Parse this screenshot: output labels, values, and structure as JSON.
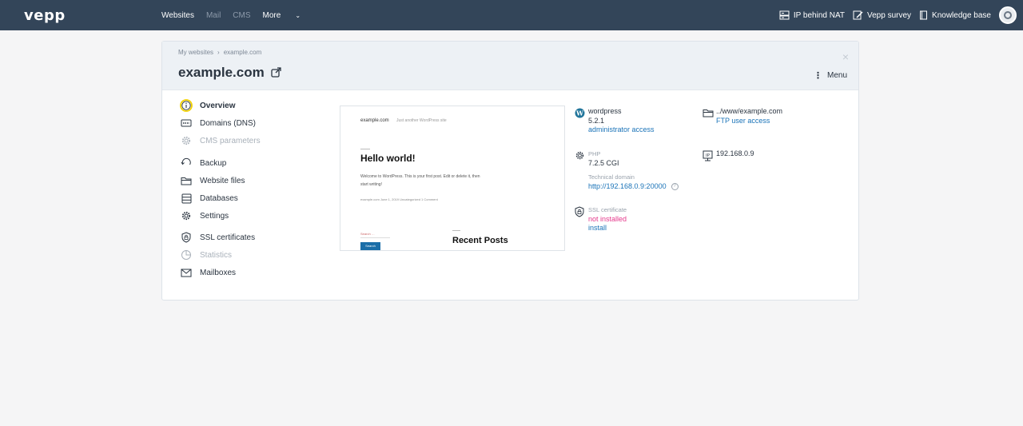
{
  "topbar": {
    "logo": "vepp",
    "nav": {
      "websites": "Websites",
      "mail": "Mail",
      "cms": "CMS",
      "more": "More"
    },
    "links": {
      "ip_behind_nat": "IP behind NAT",
      "survey": "Vepp survey",
      "knowledge_base": "Knowledge base"
    }
  },
  "card": {
    "breadcrumb": {
      "root": "My websites",
      "sep": "›",
      "current": "example.com"
    },
    "title": "example.com",
    "menu_label": "Menu",
    "close_symbol": "×"
  },
  "sidebar": {
    "items": [
      {
        "label": "Overview",
        "icon": "info-icon",
        "state": "active"
      },
      {
        "label": "Domains (DNS)",
        "icon": "dns-icon",
        "state": "normal"
      },
      {
        "label": "CMS parameters",
        "icon": "gear-icon",
        "state": "disabled"
      },
      {
        "label": "Backup",
        "icon": "backup-icon",
        "state": "normal"
      },
      {
        "label": "Website files",
        "icon": "folder-icon",
        "state": "normal"
      },
      {
        "label": "Databases",
        "icon": "database-icon",
        "state": "normal"
      },
      {
        "label": "Settings",
        "icon": "gear-icon",
        "state": "normal"
      },
      {
        "label": "SSL certificates",
        "icon": "shield-icon",
        "state": "normal"
      },
      {
        "label": "Statistics",
        "icon": "pie-chart-icon",
        "state": "disabled"
      },
      {
        "label": "Mailboxes",
        "icon": "mail-icon",
        "state": "normal"
      }
    ]
  },
  "preview": {
    "site_name": "example.com",
    "tagline": "Just another WordPress site",
    "post_title": "Hello world!",
    "post_text": "Welcome to WordPress. This is your first post. Edit or delete it, then start writing!",
    "meta": "example.com     June 1, 2019     Uncategorized     1 Comment",
    "search_placeholder": "Search …",
    "search_button": "Search",
    "recent_posts": "Recent Posts"
  },
  "info": {
    "cms_name": "wordpress",
    "cms_version": "5.2.1",
    "admin_access": "administrator access",
    "php_label": "PHP",
    "php_version": "7.2.5 CGI",
    "tech_domain_label": "Technical domain",
    "tech_domain": "http://192.168.0.9:20000",
    "help_symbol": "?",
    "ssl_label": "SSL certificate",
    "ssl_status": "not installed",
    "ssl_install": "install",
    "path": "../www/example.com",
    "ftp_access": "FTP user access",
    "ip": "192.168.0.9"
  },
  "colors": {
    "topbar": "#334559",
    "link": "#1a73b8",
    "warning": "#e5398c",
    "active_ring": "#f2d100"
  }
}
